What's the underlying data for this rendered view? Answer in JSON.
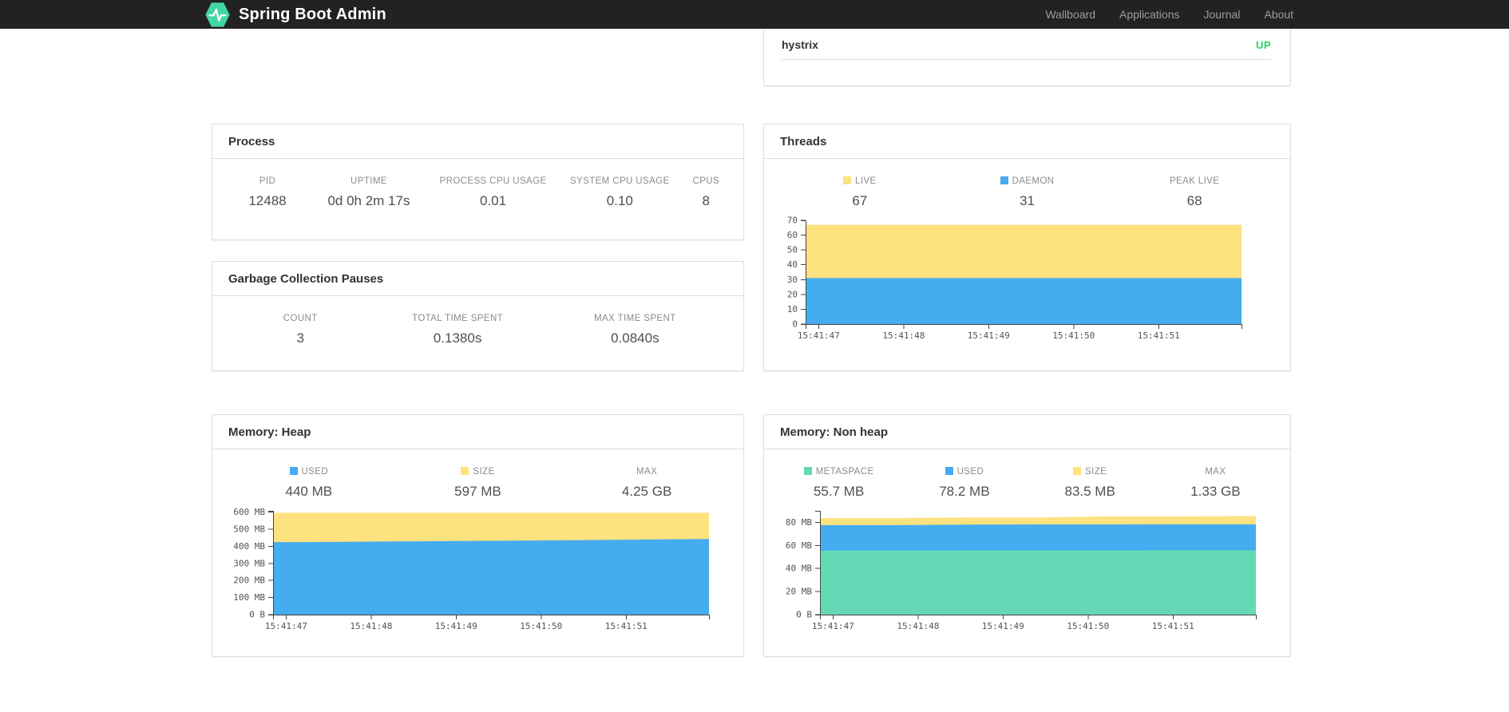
{
  "navbar": {
    "brand": "Spring Boot Admin",
    "links": [
      {
        "label": "Wallboard"
      },
      {
        "label": "Applications"
      },
      {
        "label": "Journal"
      },
      {
        "label": "About"
      }
    ]
  },
  "colors": {
    "brand_green": "#42D6A4",
    "status_up": "#26D35F",
    "series_yellow": "#FDE27F",
    "series_blue": "#45ACF0",
    "series_green": "#65D9B6"
  },
  "application": {
    "name": "hystrix",
    "status": "UP"
  },
  "process": {
    "title": "Process",
    "stats": [
      {
        "label": "PID",
        "value": "12488"
      },
      {
        "label": "UPTIME",
        "value": "0d 0h 2m 17s"
      },
      {
        "label": "PROCESS CPU USAGE",
        "value": "0.01"
      },
      {
        "label": "SYSTEM CPU USAGE",
        "value": "0.10"
      },
      {
        "label": "CPUS",
        "value": "8"
      }
    ]
  },
  "gc": {
    "title": "Garbage Collection Pauses",
    "stats": [
      {
        "label": "COUNT",
        "value": "3"
      },
      {
        "label": "TOTAL TIME SPENT",
        "value": "0.1380s"
      },
      {
        "label": "MAX TIME SPENT",
        "value": "0.0840s"
      }
    ]
  },
  "threads": {
    "title": "Threads",
    "stats": [
      {
        "label": "LIVE",
        "value": "67",
        "swatch": "#FDE27F"
      },
      {
        "label": "DAEMON",
        "value": "31",
        "swatch": "#45ACF0"
      },
      {
        "label": "PEAK LIVE",
        "value": "68"
      }
    ]
  },
  "heap": {
    "title": "Memory: Heap",
    "stats": [
      {
        "label": "USED",
        "value": "440 MB",
        "swatch": "#45ACF0"
      },
      {
        "label": "SIZE",
        "value": "597 MB",
        "swatch": "#FDE27F"
      },
      {
        "label": "MAX",
        "value": "4.25 GB"
      }
    ]
  },
  "nonheap": {
    "title": "Memory: Non heap",
    "stats": [
      {
        "label": "METASPACE",
        "value": "55.7 MB",
        "swatch": "#65D9B6"
      },
      {
        "label": "USED",
        "value": "78.2 MB",
        "swatch": "#45ACF0"
      },
      {
        "label": "SIZE",
        "value": "83.5 MB",
        "swatch": "#FDE27F"
      },
      {
        "label": "MAX",
        "value": "1.33 GB"
      }
    ]
  },
  "chart_data": {
    "threads": {
      "type": "area",
      "x_labels": [
        "15:41:47",
        "15:41:48",
        "15:41:49",
        "15:41:50",
        "15:41:51"
      ],
      "y_ticks": [
        {
          "v": 0,
          "t": "0"
        },
        {
          "v": 10,
          "t": "10"
        },
        {
          "v": 20,
          "t": "20"
        },
        {
          "v": 30,
          "t": "30"
        },
        {
          "v": 40,
          "t": "40"
        },
        {
          "v": 50,
          "t": "50"
        },
        {
          "v": 60,
          "t": "60"
        },
        {
          "v": 70,
          "t": "70"
        }
      ],
      "y_max": 70,
      "series": [
        {
          "name": "LIVE",
          "color": "#FDE27F",
          "values": [
            67,
            67,
            67,
            67,
            67,
            67,
            67
          ]
        },
        {
          "name": "DAEMON",
          "color": "#45ACF0",
          "values": [
            31,
            31,
            31,
            31,
            31,
            31,
            31
          ]
        }
      ]
    },
    "heap": {
      "type": "area",
      "x_labels": [
        "15:41:47",
        "15:41:48",
        "15:41:49",
        "15:41:50",
        "15:41:51"
      ],
      "y_ticks": [
        {
          "v": 0,
          "t": "0 B"
        },
        {
          "v": 100,
          "t": "100 MB"
        },
        {
          "v": 200,
          "t": "200 MB"
        },
        {
          "v": 300,
          "t": "300 MB"
        },
        {
          "v": 400,
          "t": "400 MB"
        },
        {
          "v": 500,
          "t": "500 MB"
        },
        {
          "v": 600,
          "t": "600 MB"
        }
      ],
      "y_max": 608,
      "series": [
        {
          "name": "SIZE",
          "color": "#FDE27F",
          "values": [
            597,
            597,
            597,
            597,
            597,
            597,
            597,
            597
          ]
        },
        {
          "name": "USED",
          "color": "#45ACF0",
          "values": [
            424,
            426,
            429,
            431,
            434,
            437,
            440,
            443
          ]
        }
      ]
    },
    "nonheap": {
      "type": "area",
      "x_labels": [
        "15:41:47",
        "15:41:48",
        "15:41:49",
        "15:41:50",
        "15:41:51"
      ],
      "y_ticks": [
        {
          "v": 0,
          "t": "0 B"
        },
        {
          "v": 20,
          "t": "20 MB"
        },
        {
          "v": 40,
          "t": "40 MB"
        },
        {
          "v": 60,
          "t": "60 MB"
        },
        {
          "v": 80,
          "t": "80 MB"
        }
      ],
      "y_max": 90,
      "series": [
        {
          "name": "SIZE",
          "color": "#FDE27F",
          "values": [
            83.8,
            83.8,
            84.2,
            84.2,
            85.2,
            85.2,
            85.4
          ]
        },
        {
          "name": "USED",
          "color": "#45ACF0",
          "values": [
            77.6,
            77.6,
            78.0,
            78.2,
            78.2,
            78.3,
            78.3
          ]
        },
        {
          "name": "METASPACE",
          "color": "#65D9B6",
          "values": [
            55.6,
            55.6,
            55.7,
            55.7,
            55.7,
            55.8,
            55.8
          ]
        }
      ]
    }
  }
}
